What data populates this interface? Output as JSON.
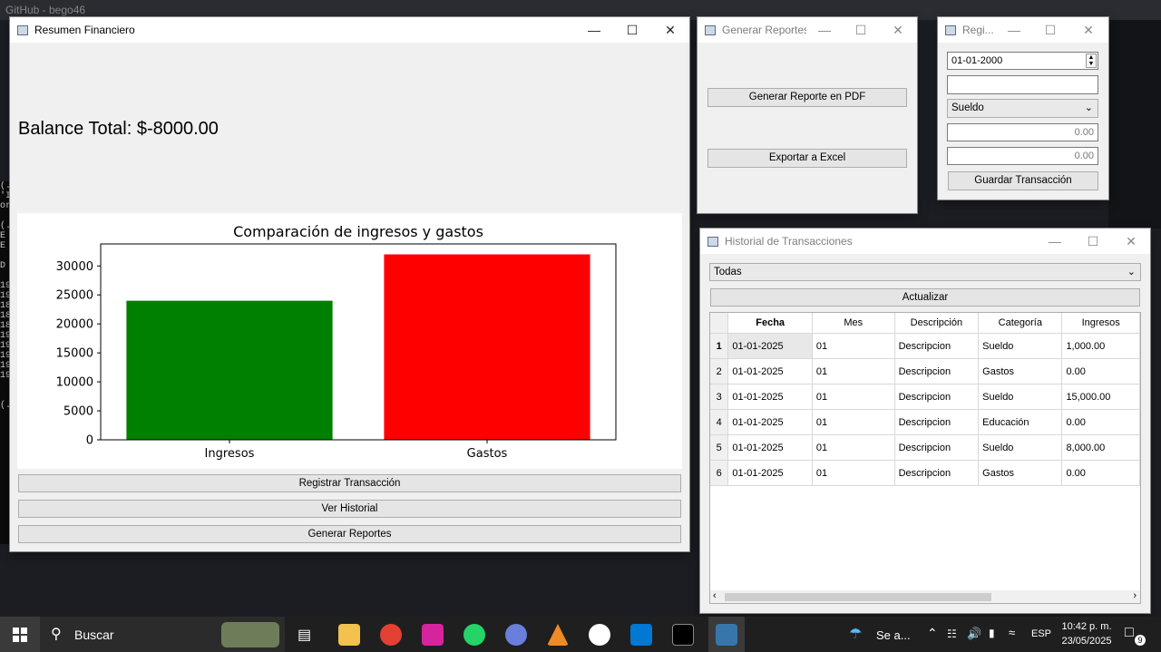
{
  "background": {
    "browser_title": "GitHub - bego46",
    "terminal_lines": [
      "(.",
      "'I",
      "or",
      "",
      "(.",
      "E",
      "E",
      "",
      "D",
      "",
      "19",
      "19",
      "18",
      "18",
      "18",
      "19",
      "19",
      "19",
      "19",
      "19",
      "",
      "",
      "(."
    ]
  },
  "summary_window": {
    "title": "Resumen Financiero",
    "balance": "Balance Total: $-8000.00",
    "buttons": {
      "register": "Registrar Transacción",
      "history": "Ver Historial",
      "reports": "Generar Reportes"
    }
  },
  "chart_data": {
    "type": "bar",
    "title": "Comparación de ingresos y gastos",
    "categories": [
      "Ingresos",
      "Gastos"
    ],
    "values": [
      24000,
      32000
    ],
    "colors": [
      "#008000",
      "#ff0000"
    ],
    "ylim": [
      0,
      33800
    ],
    "yticks": [
      "0",
      "5000",
      "10000",
      "15000",
      "20000",
      "25000",
      "30000"
    ],
    "ytick_values": [
      0,
      5000,
      10000,
      15000,
      20000,
      25000,
      30000
    ],
    "xlabel": "",
    "ylabel": "",
    "grid": false
  },
  "reports_window": {
    "title": "Generar Reportes",
    "pdf_button": "Generar Reporte en PDF",
    "excel_button": "Exportar a Excel"
  },
  "register_window": {
    "title": "Regi...",
    "date_value": "01-01-2000",
    "description_value": "",
    "category_value": "Sueldo",
    "income_value": "0.00",
    "expense_value": "0.00",
    "save_button": "Guardar Transacción"
  },
  "history_window": {
    "title": "Historial de Transacciones",
    "filter_value": "Todas",
    "refresh_button": "Actualizar",
    "columns": [
      "Fecha",
      "Mes",
      "Descripción",
      "Categoría",
      "Ingresos"
    ],
    "rows": [
      {
        "n": "1",
        "fecha": "01-01-2025",
        "mes": "01",
        "desc": "Descripcion",
        "cat": "Sueldo",
        "ing": "1,000.00"
      },
      {
        "n": "2",
        "fecha": "01-01-2025",
        "mes": "01",
        "desc": "Descripcion",
        "cat": "Gastos",
        "ing": "0.00"
      },
      {
        "n": "3",
        "fecha": "01-01-2025",
        "mes": "01",
        "desc": "Descripcion",
        "cat": "Sueldo",
        "ing": "15,000.00"
      },
      {
        "n": "4",
        "fecha": "01-01-2025",
        "mes": "01",
        "desc": "Descripcion",
        "cat": "Educación",
        "ing": "0.00"
      },
      {
        "n": "5",
        "fecha": "01-01-2025",
        "mes": "01",
        "desc": "Descripcion",
        "cat": "Sueldo",
        "ing": "8,000.00"
      },
      {
        "n": "6",
        "fecha": "01-01-2025",
        "mes": "01",
        "desc": "Descripcion",
        "cat": "Gastos",
        "ing": "0.00"
      }
    ]
  },
  "taskbar": {
    "search_label": "Buscar",
    "weather_label": "Se a...",
    "language": "ESP",
    "time": "10:42 p. m.",
    "date": "23/05/2025",
    "notification_count": "9",
    "colors": {
      "accent": "#0078d4"
    }
  }
}
